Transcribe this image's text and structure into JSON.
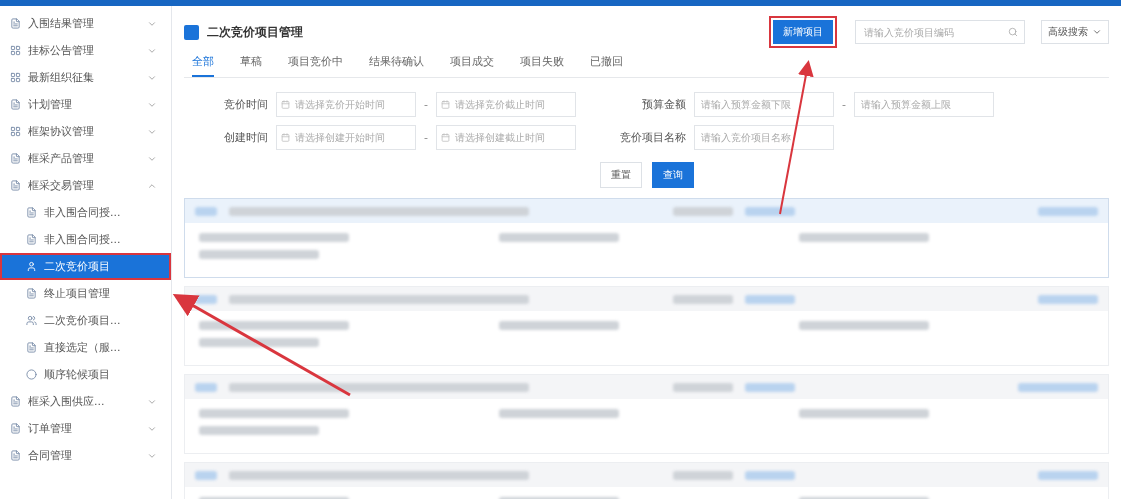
{
  "sidebar": {
    "items": [
      {
        "label": "入围结果管理",
        "expanded": false,
        "selected": false
      },
      {
        "label": "挂标公告管理",
        "expanded": false,
        "selected": false
      },
      {
        "label": "最新组织征集",
        "expanded": false,
        "selected": false
      },
      {
        "label": "计划管理",
        "expanded": false,
        "selected": false
      },
      {
        "label": "框架协议管理",
        "expanded": false,
        "selected": false
      },
      {
        "label": "框采产品管理",
        "expanded": false,
        "selected": false
      },
      {
        "label": "框采交易管理",
        "expanded": true,
        "selected": false,
        "children": [
          {
            "label": "非入围合同授...",
            "selected": false
          },
          {
            "label": "非入围合同授...",
            "selected": false
          },
          {
            "label": "二次竞价项目",
            "selected": true
          },
          {
            "label": "终止项目管理",
            "selected": false
          },
          {
            "label": "二次竞价项目...",
            "selected": false
          },
          {
            "label": "直接选定（服...",
            "selected": false
          },
          {
            "label": "顺序轮候项目",
            "selected": false
          }
        ]
      },
      {
        "label": "框采入围供应...",
        "expanded": false,
        "selected": false
      },
      {
        "label": "订单管理",
        "expanded": false,
        "selected": false
      },
      {
        "label": "合同管理",
        "expanded": false,
        "selected": false
      }
    ]
  },
  "page": {
    "title": "二次竞价项目管理",
    "new_button": "新增项目",
    "search": {
      "placeholder": "请输入竞价项目编码"
    },
    "advanced": "高级搜索"
  },
  "tabs": [
    {
      "label": "全部",
      "selected": true
    },
    {
      "label": "草稿",
      "selected": false
    },
    {
      "label": "项目竞价中",
      "selected": false
    },
    {
      "label": "结果待确认",
      "selected": false
    },
    {
      "label": "项目成交",
      "selected": false
    },
    {
      "label": "项目失败",
      "selected": false
    },
    {
      "label": "已撤回",
      "selected": false
    }
  ],
  "filters": [
    {
      "label": "竞价时间",
      "kind": "date",
      "from": {
        "placeholder": "请选择竞价开始时间"
      },
      "to": {
        "placeholder": "请选择竞价截止时间"
      }
    },
    {
      "label": "预算金额",
      "kind": "number",
      "from": {
        "placeholder": "请输入预算金额下限"
      },
      "to": {
        "placeholder": "请输入预算金额上限"
      }
    },
    {
      "label": "创建时间",
      "kind": "date",
      "from": {
        "placeholder": "请选择创建开始时间"
      },
      "to": {
        "placeholder": "请选择创建截止时间"
      }
    },
    {
      "label": "竞价项目名称",
      "kind": "text",
      "placeholder": "请输入竞价项目名称"
    }
  ],
  "range_separator": "-",
  "actions": {
    "reset": "重置",
    "query": "查询"
  },
  "list_rows": [
    {
      "selected": true
    },
    {
      "selected": false
    },
    {
      "selected": false
    },
    {
      "selected": false
    }
  ]
}
